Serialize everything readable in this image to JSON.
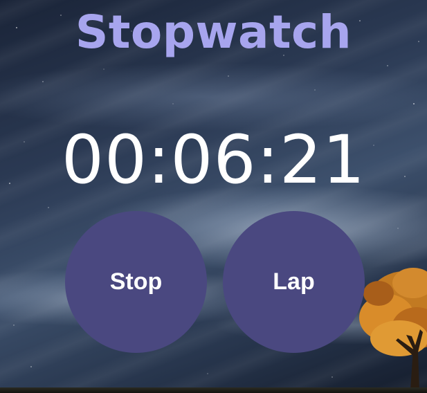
{
  "app": {
    "title": "Stopwatch"
  },
  "timer": {
    "display": "00:06:21"
  },
  "controls": {
    "stop_label": "Stop",
    "lap_label": "Lap"
  },
  "colors": {
    "title": "#a7a5ee",
    "button": "#4a4880",
    "time": "#ffffff"
  }
}
